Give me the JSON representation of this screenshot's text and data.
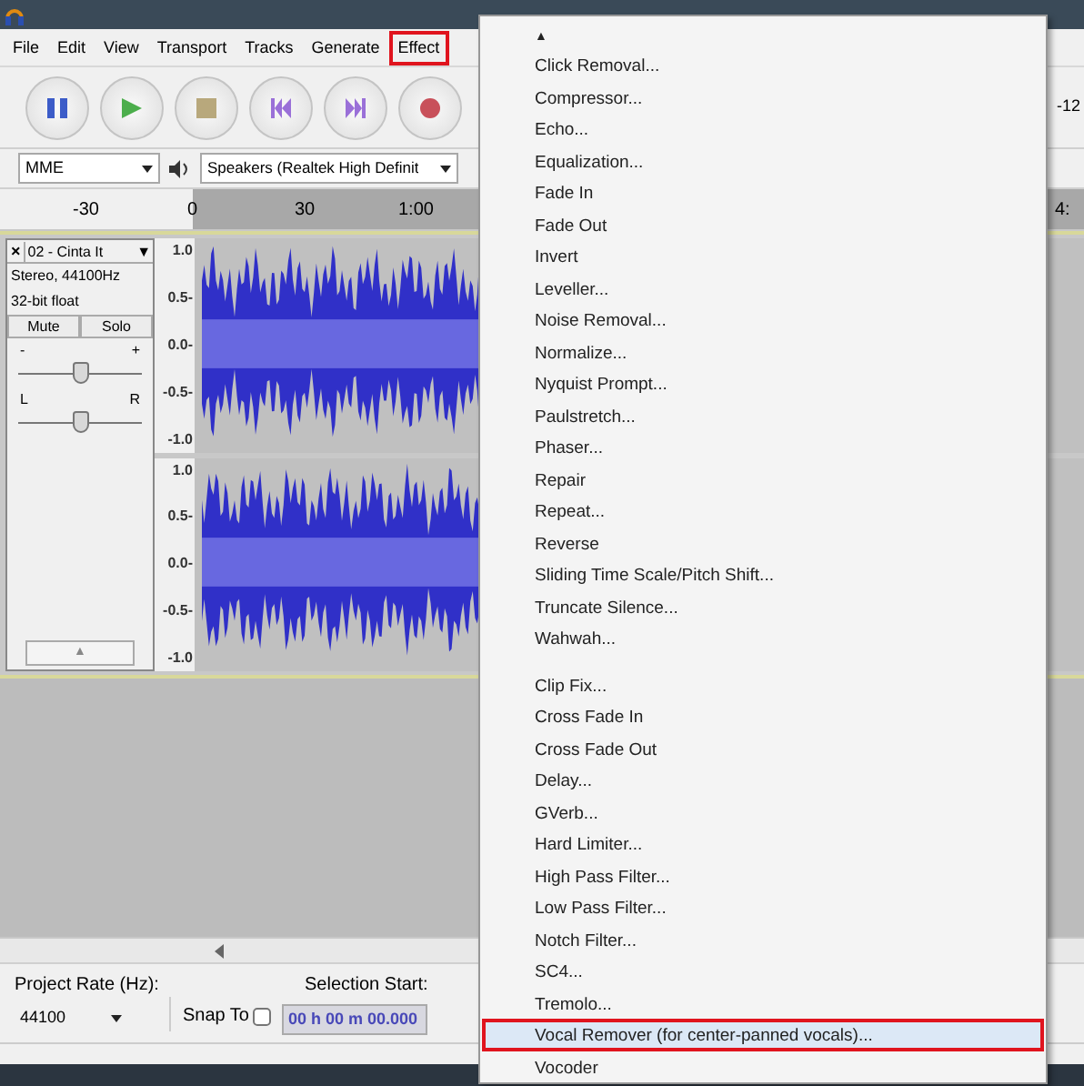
{
  "menu_bar": [
    {
      "label": "File",
      "selected": false
    },
    {
      "label": "Edit",
      "selected": false
    },
    {
      "label": "View",
      "selected": false
    },
    {
      "label": "Transport",
      "selected": false
    },
    {
      "label": "Tracks",
      "selected": false
    },
    {
      "label": "Generate",
      "selected": false
    },
    {
      "label": "Effect",
      "selected": true
    }
  ],
  "transport": [
    {
      "kind": "pause"
    },
    {
      "kind": "play"
    },
    {
      "kind": "stop"
    },
    {
      "kind": "skip-start"
    },
    {
      "kind": "skip-end"
    },
    {
      "kind": "record"
    }
  ],
  "device_bar": {
    "host": "MME",
    "output": "Speakers (Realtek High Definit"
  },
  "ruler": [
    "-30",
    "0",
    "30",
    "1:00"
  ],
  "meter_tick": "-12",
  "ruler_right": "4:",
  "track": {
    "name": "02 - Cinta It",
    "close": "×",
    "dropdown": "▼",
    "format": "Stereo, 44100Hz",
    "bits": "32-bit float",
    "buttons": [
      "Mute",
      "Solo"
    ],
    "gain": {
      "min": "-",
      "max": "+",
      "level": 0.5
    },
    "pan": {
      "min": "L",
      "max": "R",
      "level": 0.5
    },
    "collapse": "▲",
    "channels": [
      {
        "scale": [
          "1.0",
          "0.5-",
          "0.0-",
          "-0.5-",
          "-1.0"
        ]
      },
      {
        "scale": [
          "1.0",
          "0.5-",
          "0.0-",
          "-0.5-",
          "-1.0"
        ]
      }
    ]
  },
  "selection_bar": {
    "rate_label": "Project Rate (Hz):",
    "rate": "44100",
    "snap_label": "Snap To",
    "snap_checked": false,
    "start_label": "Selection Start:",
    "start": "00 h 00 m 00.000"
  },
  "effect_menu": {
    "scroll_up": "▲",
    "groups": [
      {
        "items": [
          {
            "label": "Click Removal...",
            "selected": false
          },
          {
            "label": "Compressor...",
            "selected": false
          },
          {
            "label": "Echo...",
            "selected": false
          },
          {
            "label": "Equalization...",
            "selected": false
          },
          {
            "label": "Fade In",
            "selected": false
          },
          {
            "label": "Fade Out",
            "selected": false
          },
          {
            "label": "Invert",
            "selected": false
          },
          {
            "label": "Leveller...",
            "selected": false
          },
          {
            "label": "Noise Removal...",
            "selected": false
          },
          {
            "label": "Normalize...",
            "selected": false
          },
          {
            "label": "Nyquist Prompt...",
            "selected": false
          },
          {
            "label": "Paulstretch...",
            "selected": false
          },
          {
            "label": "Phaser...",
            "selected": false
          },
          {
            "label": "Repair",
            "selected": false
          },
          {
            "label": "Repeat...",
            "selected": false
          },
          {
            "label": "Reverse",
            "selected": false
          },
          {
            "label": "Sliding Time Scale/Pitch Shift...",
            "selected": false
          },
          {
            "label": "Truncate Silence...",
            "selected": false
          },
          {
            "label": "Wahwah...",
            "selected": false
          }
        ]
      },
      {
        "items": [
          {
            "label": "Clip Fix...",
            "selected": false
          },
          {
            "label": "Cross Fade In",
            "selected": false
          },
          {
            "label": "Cross Fade Out",
            "selected": false
          },
          {
            "label": "Delay...",
            "selected": false
          },
          {
            "label": "GVerb...",
            "selected": false
          },
          {
            "label": "Hard Limiter...",
            "selected": false
          },
          {
            "label": "High Pass Filter...",
            "selected": false
          },
          {
            "label": "Low Pass Filter...",
            "selected": false
          },
          {
            "label": "Notch Filter...",
            "selected": false
          },
          {
            "label": "SC4...",
            "selected": false
          },
          {
            "label": "Tremolo...",
            "selected": false
          },
          {
            "label": "Vocal Remover (for center-panned vocals)...",
            "selected": true
          },
          {
            "label": "Vocoder",
            "selected": false
          }
        ]
      }
    ]
  }
}
